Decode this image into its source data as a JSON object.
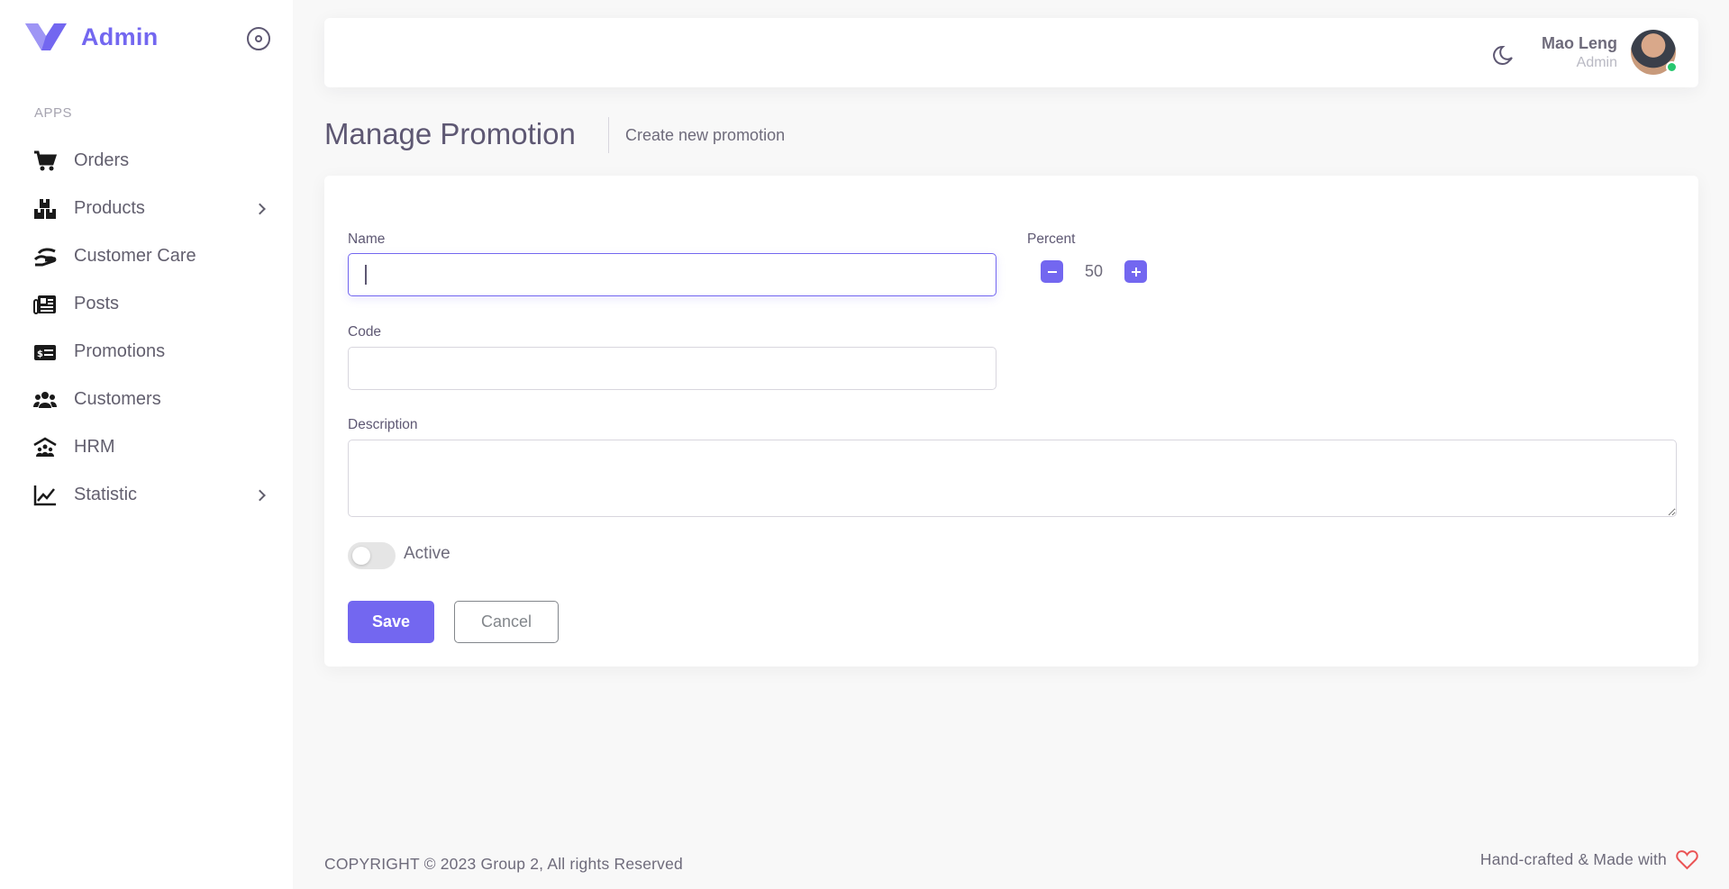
{
  "brand": {
    "name": "Admin",
    "accent": "#7367f0"
  },
  "sidebar": {
    "section_label": "APPS",
    "items": [
      {
        "label": "Orders",
        "icon": "cart-icon",
        "has_children": false
      },
      {
        "label": "Products",
        "icon": "boxes-icon",
        "has_children": true
      },
      {
        "label": "Customer Care",
        "icon": "hand-holding-icon",
        "has_children": false
      },
      {
        "label": "Posts",
        "icon": "newspaper-icon",
        "has_children": false
      },
      {
        "label": "Promotions",
        "icon": "money-check-icon",
        "has_children": false
      },
      {
        "label": "Customers",
        "icon": "users-icon",
        "has_children": false
      },
      {
        "label": "HRM",
        "icon": "people-roof-icon",
        "has_children": false
      },
      {
        "label": "Statistic",
        "icon": "chart-line-icon",
        "has_children": true
      }
    ]
  },
  "header": {
    "user_name": "Mao Leng",
    "user_role": "Admin",
    "status_color": "#28c76f"
  },
  "page": {
    "title": "Manage Promotion",
    "breadcrumb": "Create new promotion"
  },
  "form": {
    "name_label": "Name",
    "name_value": "",
    "percent_label": "Percent",
    "percent_value": "50",
    "code_label": "Code",
    "code_value": "",
    "description_label": "Description",
    "description_value": "",
    "active_label": "Active",
    "active": false,
    "save_label": "Save",
    "cancel_label": "Cancel"
  },
  "footer": {
    "copyright": "COPYRIGHT © 2023 Group 2, All rights Reserved",
    "made_with": "Hand-crafted & Made with",
    "heart_icon": "heart-icon"
  }
}
